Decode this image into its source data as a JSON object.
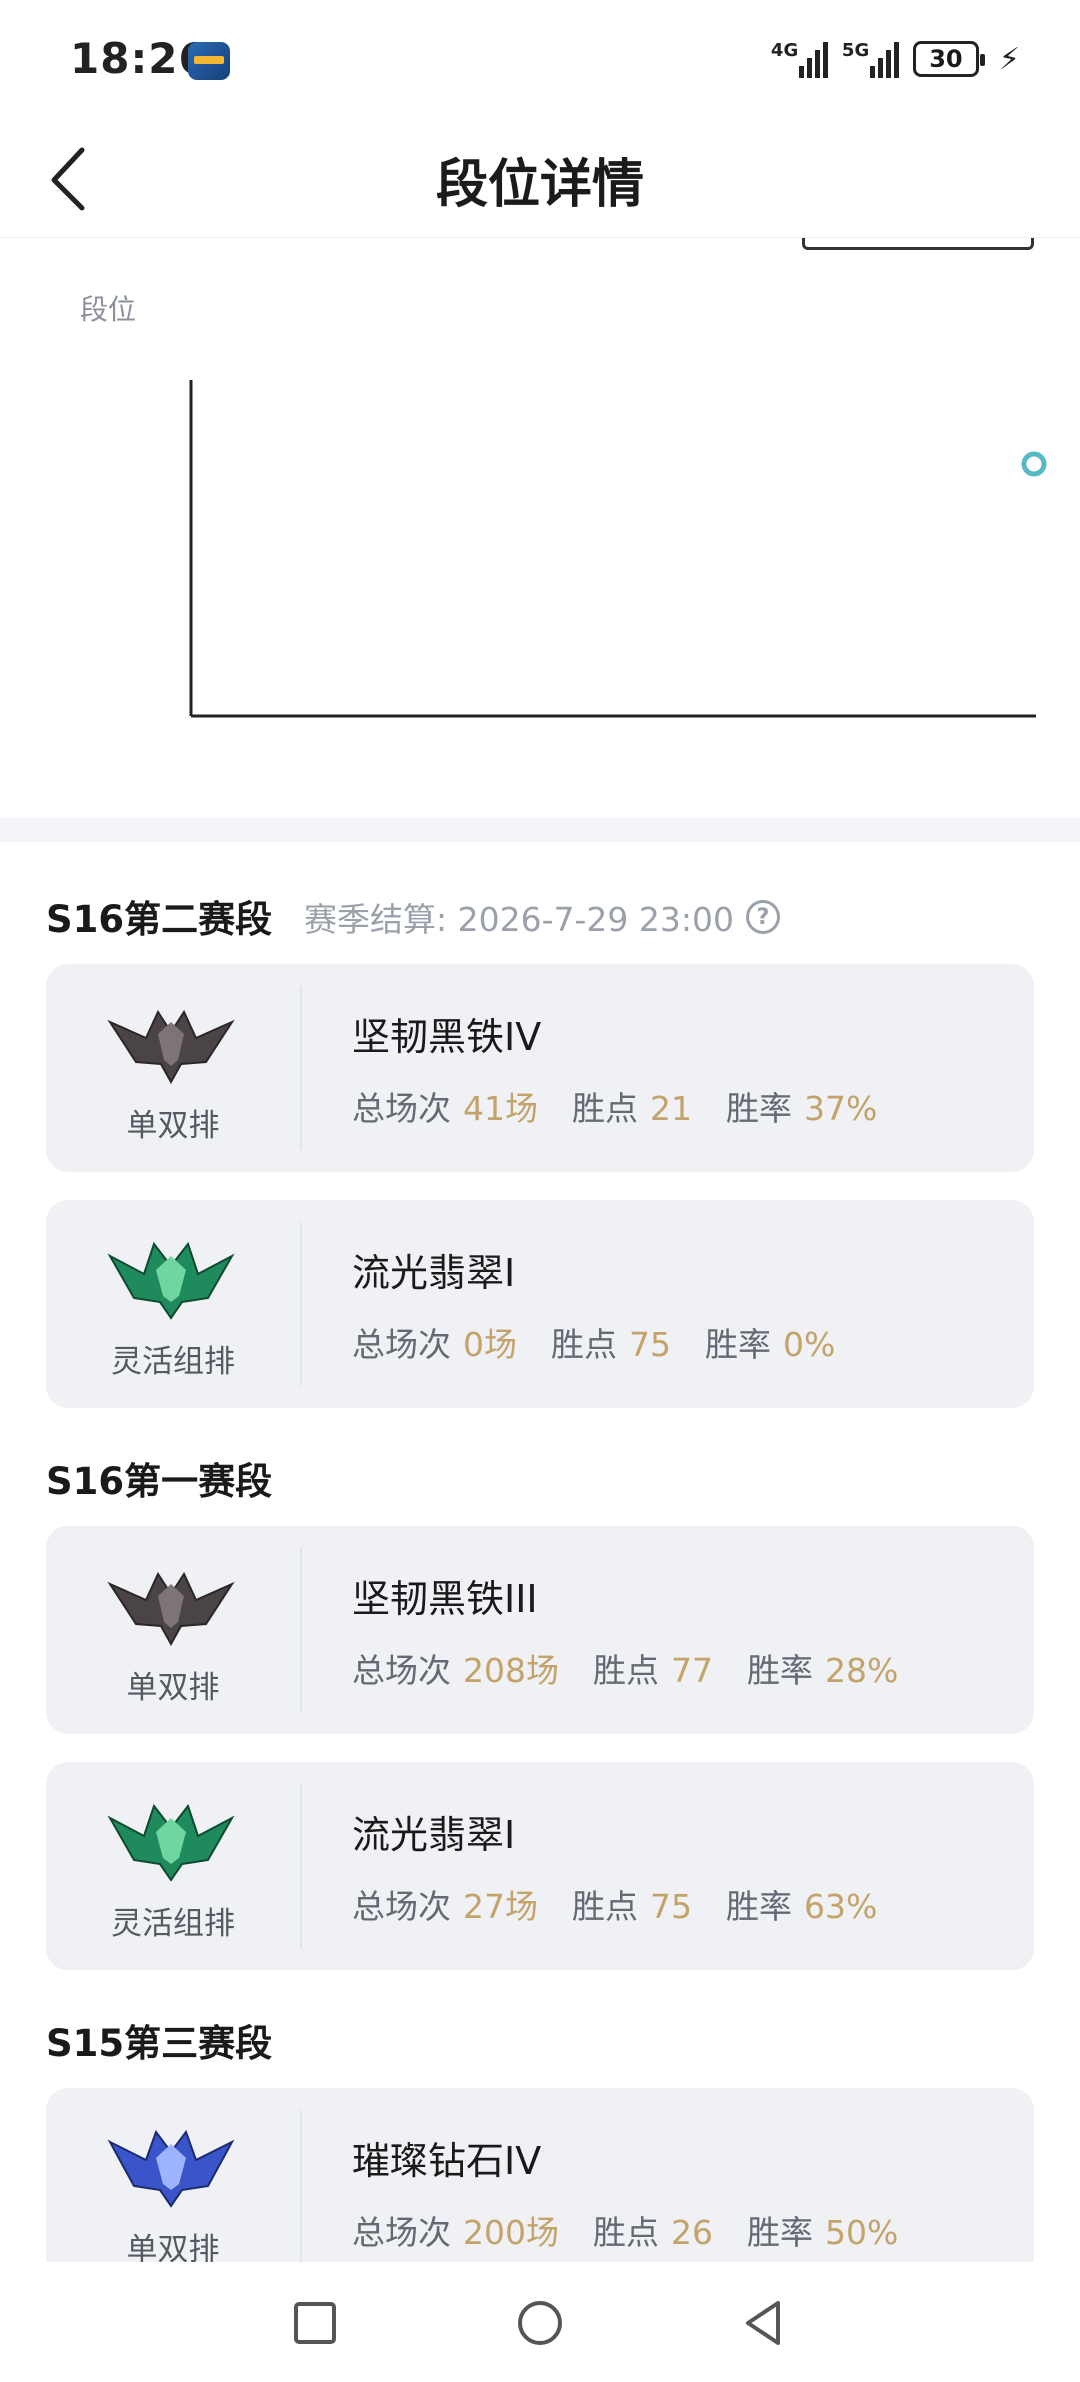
{
  "status_bar": {
    "time": "18:26",
    "signal1_label": "4G",
    "signal2_label": "5G",
    "battery": "30",
    "icons": [
      "app-notification-icon",
      "signal-icon",
      "battery-icon",
      "charging-bolt-icon"
    ]
  },
  "header": {
    "title": "段位详情",
    "back_icon": "chevron-left-icon"
  },
  "chart": {
    "y_axis_label": "段位",
    "accent_color": "#5ab8c4"
  },
  "seasons": [
    {
      "title": "S16第二赛段",
      "settlement": "赛季结算: 2026-7-29 23:00",
      "help_icon": "?",
      "cards": [
        {
          "queue": "单双排",
          "rank": "坚韧黑铁IV",
          "games_label": "总场次",
          "games": "41场",
          "lp_label": "胜点",
          "lp": "21",
          "wr_label": "胜率",
          "wr": "37%",
          "tier": "iron"
        },
        {
          "queue": "灵活组排",
          "rank": "流光翡翠I",
          "games_label": "总场次",
          "games": "0场",
          "lp_label": "胜点",
          "lp": "75",
          "wr_label": "胜率",
          "wr": "0%",
          "tier": "emerald"
        }
      ]
    },
    {
      "title": "S16第一赛段",
      "cards": [
        {
          "queue": "单双排",
          "rank": "坚韧黑铁III",
          "games_label": "总场次",
          "games": "208场",
          "lp_label": "胜点",
          "lp": "77",
          "wr_label": "胜率",
          "wr": "28%",
          "tier": "iron"
        },
        {
          "queue": "灵活组排",
          "rank": "流光翡翠I",
          "games_label": "总场次",
          "games": "27场",
          "lp_label": "胜点",
          "lp": "75",
          "wr_label": "胜率",
          "wr": "63%",
          "tier": "emerald"
        }
      ]
    },
    {
      "title": "S15第三赛段",
      "cards": [
        {
          "queue": "单双排",
          "rank": "璀璨钻石IV",
          "games_label": "总场次",
          "games": "200场",
          "lp_label": "胜点",
          "lp": "26",
          "wr_label": "胜率",
          "wr": "50%",
          "tier": "diamond"
        }
      ]
    }
  ],
  "colors": {
    "stat_value": "#c4a36a",
    "card_bg": "#eff1f5",
    "iron": "#4a4446",
    "emerald": "#1f8a5c",
    "diamond": "#3a55c9"
  },
  "bottom_nav": [
    "recent-apps-square-icon",
    "home-circle-icon",
    "back-triangle-icon"
  ]
}
